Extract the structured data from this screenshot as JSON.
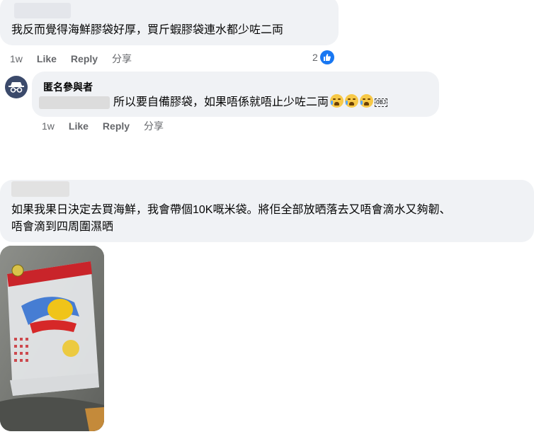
{
  "comment1": {
    "text": "我反而覺得海鮮膠袋好厚，買斤蝦膠袋連水都少咗二両",
    "time": "1w",
    "like": "Like",
    "reply": "Reply",
    "share": "分享",
    "reaction_count": "2"
  },
  "reply1": {
    "author": "匿名參與者",
    "text": "所以要自備膠袋，如果唔係就唔止少咗二両",
    "obj_glyph": "OBJ",
    "time": "1w",
    "like": "Like",
    "reply": "Reply",
    "share": "分享"
  },
  "comment2": {
    "line1": "如果我果日決定去買海鮮，我會帶個10K嘅米袋。將佢全部放晒落去又唔會滴水又夠韌、",
    "line2": "唔會滴到四周圍濕晒"
  },
  "colors": {
    "bubble": "#f0f2f5",
    "meta": "#65676b",
    "like_blue": "#1877f2"
  },
  "icons": [
    "thumbs-up-icon",
    "incognito-avatar-icon",
    "crying-emoji-icon"
  ]
}
